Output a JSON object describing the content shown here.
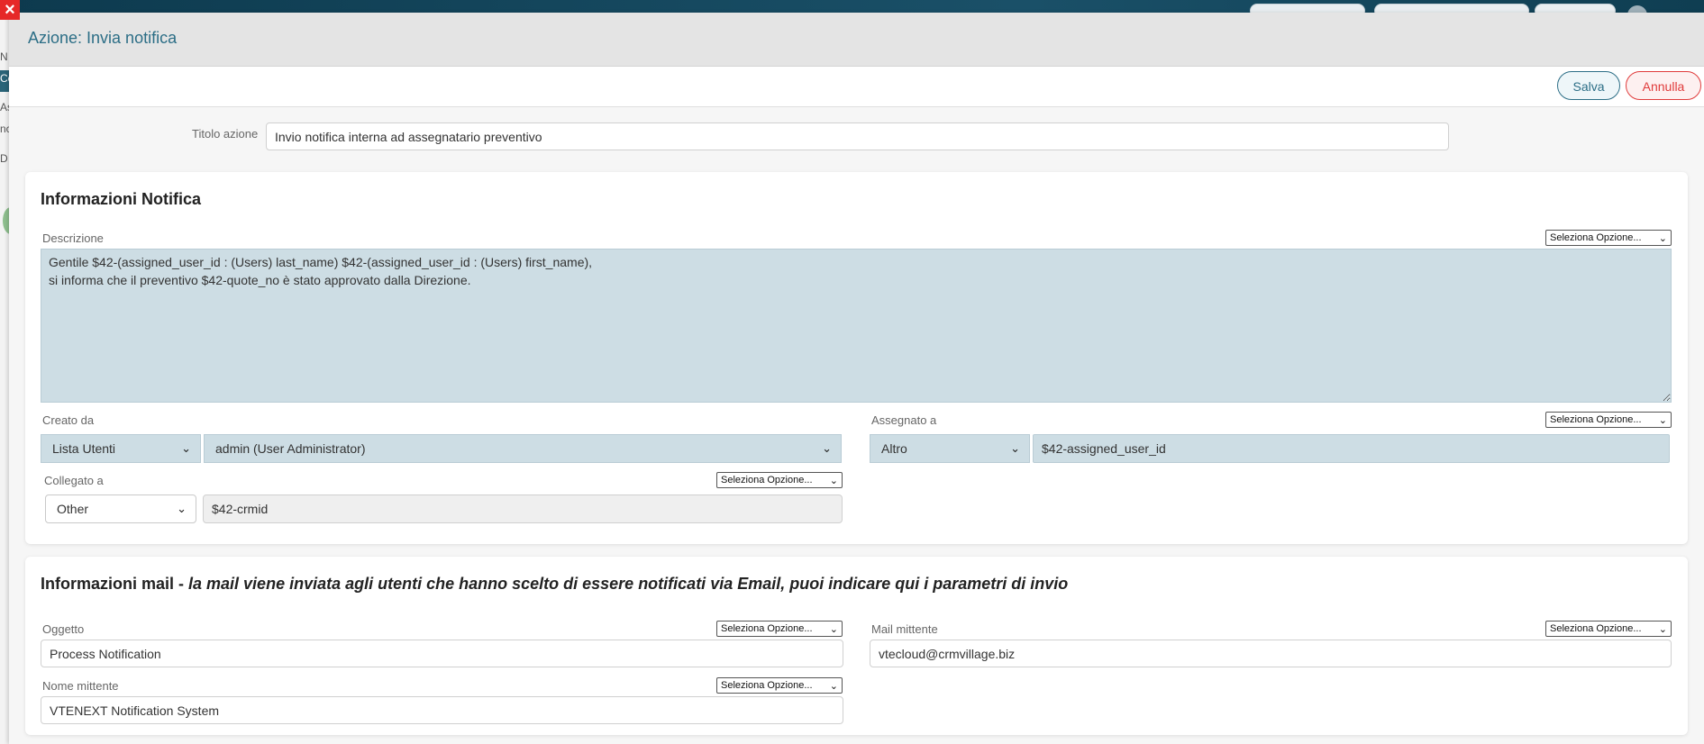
{
  "modal": {
    "title": "Azione: Invia notifica",
    "close_icon": "close-icon",
    "save_label": "Salva",
    "cancel_label": "Annulla"
  },
  "background_app": {
    "sidebar_fragments": [
      "N",
      "Co",
      "As",
      "nc",
      "D"
    ]
  },
  "action_title": {
    "label": "Titolo azione",
    "value": "Invio notifica interna ad assegnatario preventivo"
  },
  "notification_section": {
    "title": "Informazioni Notifica",
    "description_label": "Descrizione",
    "description_select": "Seleziona Opzione...",
    "description_value": "Gentile $42-(assigned_user_id : (Users) last_name) $42-(assigned_user_id : (Users) first_name),\nsi informa che il preventivo $42-quote_no è stato approvato dalla Direzione.",
    "created_by_label": "Creato da",
    "created_by_type": "Lista Utenti",
    "created_by_value": "admin (User Administrator)",
    "assigned_to_label": "Assegnato a",
    "assigned_to_select": "Seleziona Opzione...",
    "assigned_to_type": "Altro",
    "assigned_to_value": "$42-assigned_user_id",
    "linked_to_label": "Collegato a",
    "linked_to_select": "Seleziona Opzione...",
    "linked_to_type": "Other",
    "linked_to_value": "$42-crmid"
  },
  "mail_section": {
    "title": "Informazioni mail - ",
    "title_note": "la mail viene inviata agli utenti che hanno scelto di essere notificati via Email, puoi indicare qui i parametri di invio",
    "subject_label": "Oggetto",
    "subject_select": "Seleziona Opzione...",
    "subject_value": "Process Notification",
    "sender_mail_label": "Mail mittente",
    "sender_mail_select": "Seleziona Opzione...",
    "sender_mail_value": "vtecloud@crmvillage.biz",
    "sender_name_label": "Nome mittente",
    "sender_name_select": "Seleziona Opzione...",
    "sender_name_value": "VTENEXT Notification System"
  },
  "colors": {
    "accent": "#2c6e86",
    "cancel": "#e03b3b",
    "field_blue": "#cddde4",
    "header_bg": "#e4e4e4"
  }
}
